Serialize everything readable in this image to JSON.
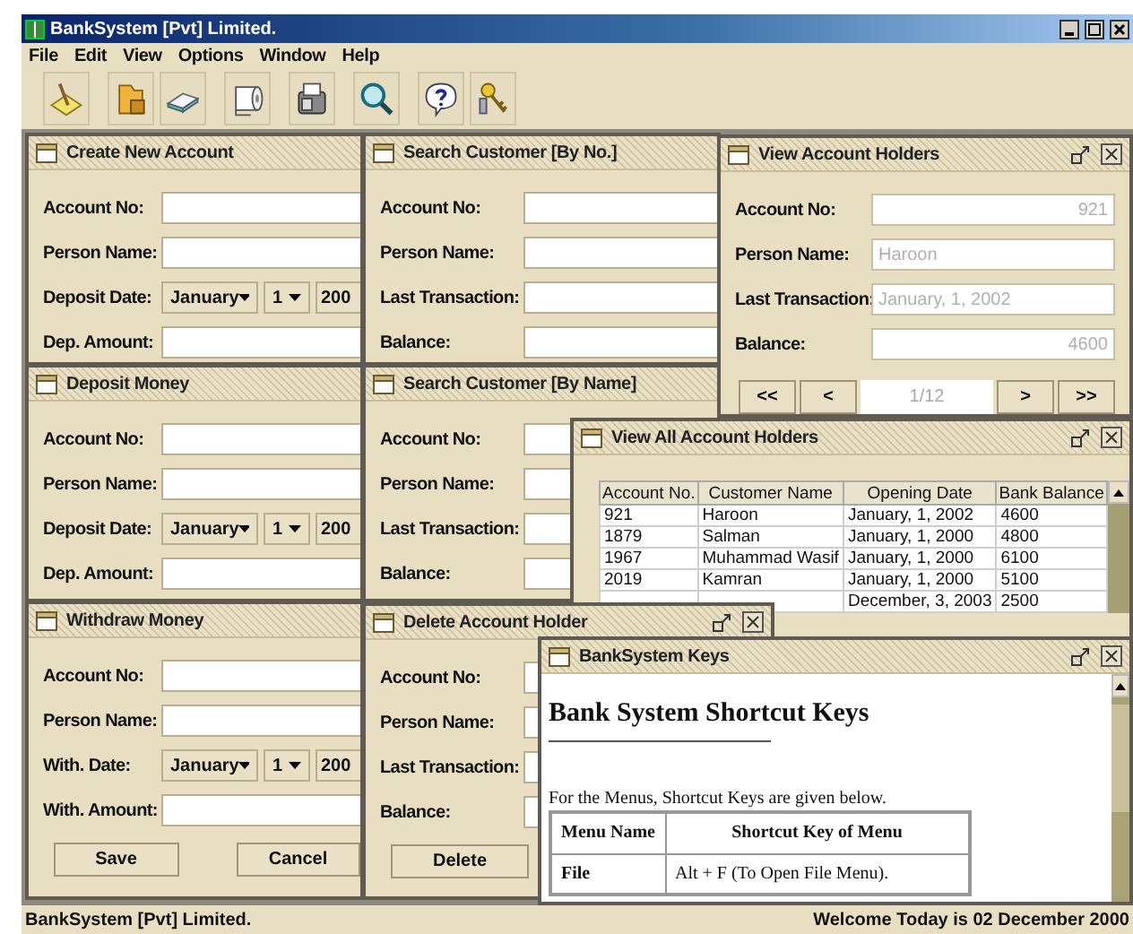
{
  "window": {
    "title": "BankSystem [Pvt] Limited."
  },
  "menu": [
    "File",
    "Edit",
    "View",
    "Options",
    "Window",
    "Help"
  ],
  "frames": [
    {
      "kind": "form",
      "title": "Create New Account",
      "controls": false,
      "rows": [
        {
          "kind": "text",
          "label": "Account No:"
        },
        {
          "kind": "text",
          "label": "Person Name:"
        },
        {
          "kind": "date",
          "label": "Deposit Date:",
          "month": "January",
          "day": "1",
          "year": "200"
        },
        {
          "kind": "text",
          "label": "Dep. Amount:"
        }
      ]
    },
    {
      "kind": "form",
      "title": "Search Customer [By No.]",
      "controls": false,
      "rows": [
        {
          "kind": "text",
          "label": "Account No:"
        },
        {
          "kind": "text",
          "label": "Person Name:"
        },
        {
          "kind": "text",
          "label": "Last Transaction:"
        },
        {
          "kind": "text",
          "label": "Balance:"
        }
      ]
    },
    {
      "kind": "viewer",
      "title": "View Account Holders",
      "controls": true,
      "rows": [
        {
          "kind": "number",
          "label": "Account No:",
          "value": "921",
          "disabled": true
        },
        {
          "kind": "text",
          "label": "Person Name:",
          "value": "Haroon",
          "disabled": true
        },
        {
          "kind": "text",
          "label": "Last Transaction:",
          "value": "January, 1, 2002",
          "disabled": true
        },
        {
          "kind": "number",
          "label": "Balance:",
          "value": "4600",
          "disabled": true
        }
      ],
      "nav": {
        "back": [
          "<<",
          "<"
        ],
        "page": "1/12",
        "forward": [
          ">",
          ">>"
        ]
      }
    },
    {
      "kind": "form",
      "title": "Deposit Money",
      "controls": false,
      "rows": [
        {
          "kind": "text",
          "label": "Account No:"
        },
        {
          "kind": "text",
          "label": "Person Name:"
        },
        {
          "kind": "date",
          "label": "Deposit Date:",
          "month": "January",
          "day": "1",
          "year": "200"
        },
        {
          "kind": "text",
          "label": "Dep. Amount:"
        }
      ]
    },
    {
      "kind": "form",
      "title": "Search Customer [By Name]",
      "controls": false,
      "rows": [
        {
          "kind": "text",
          "label": "Account No:"
        },
        {
          "kind": "text",
          "label": "Person Name:"
        },
        {
          "kind": "text",
          "label": "Last Transaction:"
        },
        {
          "kind": "text",
          "label": "Balance:"
        }
      ]
    },
    {
      "kind": "table",
      "title": "View All Account Holders",
      "controls": true,
      "columns": [
        "Account No.",
        "Customer Name",
        "Opening Date",
        "Bank Balance"
      ],
      "rows": [
        [
          "921",
          "Haroon",
          "January, 1, 2002",
          "4600"
        ],
        [
          "1879",
          "Salman",
          "January, 1, 2000",
          "4800"
        ],
        [
          "1967",
          "Muhammad Wasif",
          "January, 1, 2000",
          "6100"
        ],
        [
          "2019",
          "Kamran",
          "January, 1, 2000",
          "5100"
        ],
        [
          null,
          null,
          "December, 3, 2003",
          "2500"
        ]
      ]
    },
    {
      "kind": "form",
      "title": "Withdraw Money",
      "controls": false,
      "rows": [
        {
          "kind": "text",
          "label": "Account No:"
        },
        {
          "kind": "text",
          "label": "Person Name:"
        },
        {
          "kind": "date",
          "label": "With. Date:",
          "month": "January",
          "day": "1",
          "year": "200"
        },
        {
          "kind": "text",
          "label": "With. Amount:"
        }
      ],
      "buttons": [
        "Save",
        "Cancel"
      ]
    },
    {
      "kind": "form",
      "title": "Delete Account Holder",
      "controls": true,
      "rows": [
        {
          "kind": "text",
          "label": "Account No:"
        },
        {
          "kind": "text",
          "label": "Person Name:"
        },
        {
          "kind": "text",
          "label": "Last Transaction:"
        },
        {
          "kind": "text",
          "label": "Balance:"
        }
      ],
      "buttons": [
        "Delete"
      ]
    },
    {
      "kind": "html",
      "title": "BankSystem Keys",
      "controls": true,
      "heading": "Bank System Shortcut Keys",
      "text": "For the Menus, Shortcut Keys are given below.",
      "columns": [
        "Menu Name",
        "Shortcut Key of Menu"
      ],
      "rows": [
        [
          "File",
          "Alt + F (To Open File Menu)."
        ]
      ]
    }
  ],
  "status_bar": {
    "left": "BankSystem [Pvt] Limited.",
    "right": "Welcome Today is 02 December 2000"
  }
}
